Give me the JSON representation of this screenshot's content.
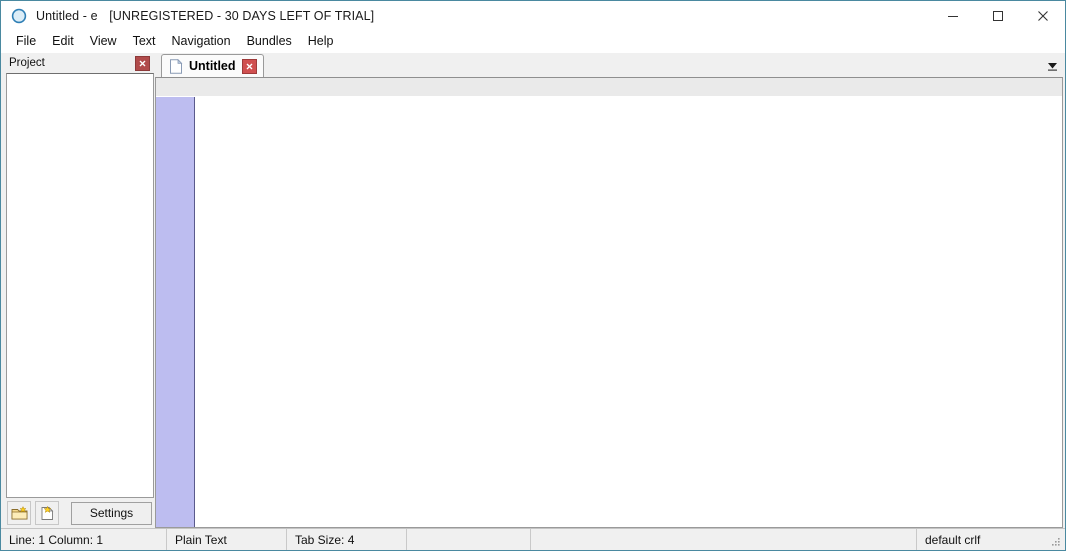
{
  "window": {
    "icon": "app-globe-icon",
    "title_name": "Untitled - e",
    "title_trial": "[UNREGISTERED - 30 DAYS LEFT OF TRIAL]",
    "controls": {
      "minimize": "minimize-icon",
      "maximize": "maximize-icon",
      "close": "close-icon"
    },
    "border_color": "#4a89a0"
  },
  "menubar": {
    "items": [
      {
        "label": "File"
      },
      {
        "label": "Edit"
      },
      {
        "label": "View"
      },
      {
        "label": "Text"
      },
      {
        "label": "Navigation"
      },
      {
        "label": "Bundles"
      },
      {
        "label": "Help"
      }
    ]
  },
  "project_panel": {
    "header_label": "Project",
    "close_icon": "close-icon",
    "tree_items": [],
    "toolbar": {
      "new_folder_icon": "new-folder-icon",
      "new_file_icon": "new-file-icon",
      "settings_label": "Settings"
    }
  },
  "editor": {
    "tabs": [
      {
        "label": "Untitled",
        "icon": "document-icon",
        "close_icon": "close-icon",
        "active": true
      }
    ],
    "tab_dropdown_icon": "chevron-down-icon",
    "content": "",
    "gutter_color": "#bdbdf0"
  },
  "statusbar": {
    "position": "Line: 1  Column: 1",
    "language": "Plain Text",
    "tab_size": "Tab Size: 4",
    "line_endings": "default crlf",
    "grip_icon": "resize-grip-icon"
  }
}
